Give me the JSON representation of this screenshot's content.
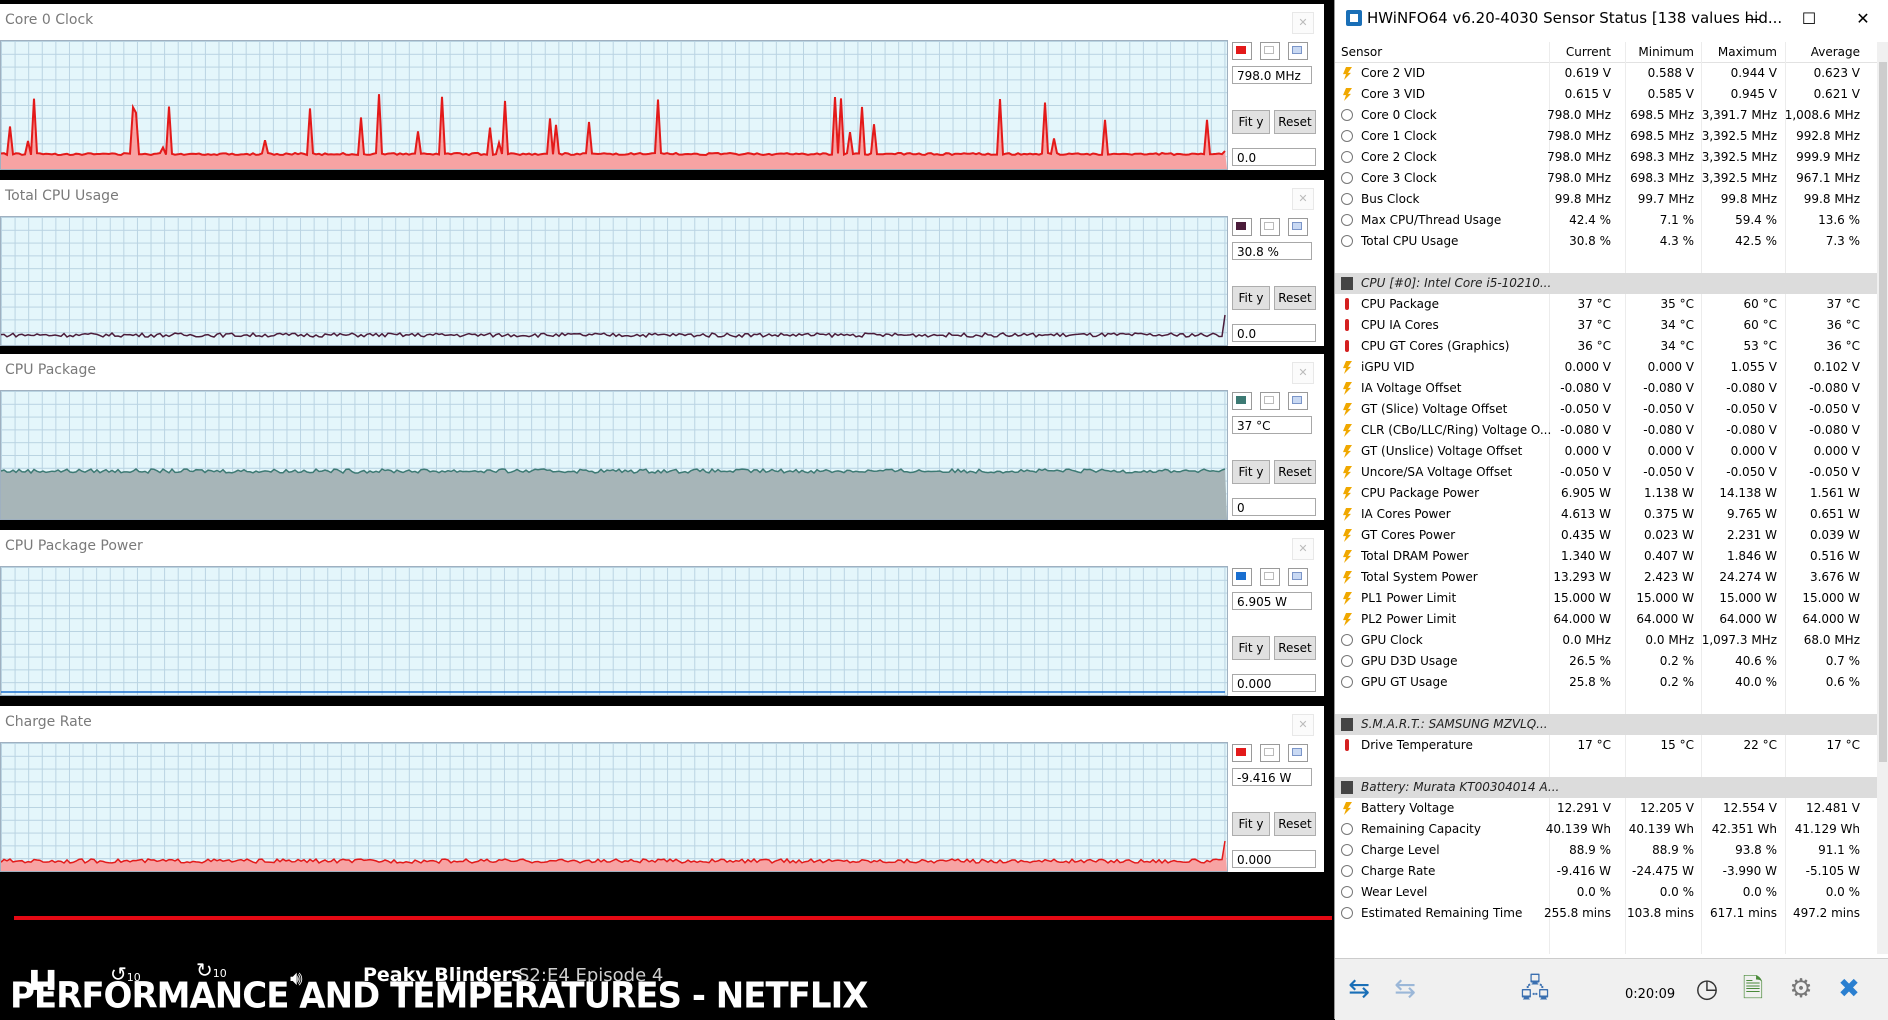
{
  "graphs": [
    {
      "title": "Core 0 Clock",
      "color": "#e31a1a",
      "fill": "#f7a3a3",
      "value": "798.0 MHz",
      "min": "0.0",
      "fit": "Fit y",
      "reset": "Reset",
      "kind": "spikes"
    },
    {
      "title": "Total CPU Usage",
      "color": "#4b1c3a",
      "fill": "",
      "value": "30.8 %",
      "min": "0.0",
      "fit": "Fit y",
      "reset": "Reset",
      "kind": "low"
    },
    {
      "title": "CPU Package",
      "color": "#3d7a74",
      "fill": "#a7b5b8",
      "value": "37 °C",
      "min": "0",
      "fit": "Fit y",
      "reset": "Reset",
      "kind": "mid"
    },
    {
      "title": "CPU Package Power",
      "color": "#1a6fd0",
      "fill": "",
      "value": "6.905 W",
      "min": "0.000",
      "fit": "Fit y",
      "reset": "Reset",
      "kind": "flat"
    },
    {
      "title": "Charge Rate",
      "color": "#e31a1a",
      "fill": "#f7a3a3",
      "value": "-9.416 W",
      "min": "0.000",
      "fit": "Fit y",
      "reset": "Reset",
      "kind": "low"
    }
  ],
  "video": {
    "show_title": "Peaky Blinders",
    "episode": "S2:E4  Episode 4",
    "rewind_label": "10",
    "forward_label": "10",
    "caption": "PERFORMANCE AND TEMPERATURES - NETFLIX"
  },
  "window": {
    "title": "HWiNFO64 v6.20-4030 Sensor Status [138 values hid...",
    "min": "—",
    "max": "☐",
    "close": "✕",
    "headers": [
      "Sensor",
      "Current",
      "Minimum",
      "Maximum",
      "Average"
    ],
    "timer": "0:20:09"
  },
  "rows": [
    {
      "t": "volt",
      "n": "Core 2 VID",
      "c": "0.619 V",
      "mn": "0.588 V",
      "mx": "0.944 V",
      "av": "0.623 V"
    },
    {
      "t": "volt",
      "n": "Core 3 VID",
      "c": "0.615 V",
      "mn": "0.585 V",
      "mx": "0.945 V",
      "av": "0.621 V"
    },
    {
      "t": "clock",
      "n": "Core 0 Clock",
      "c": "798.0 MHz",
      "mn": "698.5 MHz",
      "mx": "3,391.7 MHz",
      "av": "1,008.6 MHz"
    },
    {
      "t": "clock",
      "n": "Core 1 Clock",
      "c": "798.0 MHz",
      "mn": "698.5 MHz",
      "mx": "3,392.5 MHz",
      "av": "992.8 MHz"
    },
    {
      "t": "clock",
      "n": "Core 2 Clock",
      "c": "798.0 MHz",
      "mn": "698.3 MHz",
      "mx": "3,392.5 MHz",
      "av": "999.9 MHz"
    },
    {
      "t": "clock",
      "n": "Core 3 Clock",
      "c": "798.0 MHz",
      "mn": "698.3 MHz",
      "mx": "3,392.5 MHz",
      "av": "967.1 MHz"
    },
    {
      "t": "clock",
      "n": "Bus Clock",
      "c": "99.8 MHz",
      "mn": "99.7 MHz",
      "mx": "99.8 MHz",
      "av": "99.8 MHz"
    },
    {
      "t": "clock",
      "n": "Max CPU/Thread Usage",
      "c": "42.4 %",
      "mn": "7.1 %",
      "mx": "59.4 %",
      "av": "13.6 %"
    },
    {
      "t": "clock",
      "n": "Total CPU Usage",
      "c": "30.8 %",
      "mn": "4.3 %",
      "mx": "42.5 %",
      "av": "7.3 %"
    },
    {
      "t": "blank"
    },
    {
      "t": "group",
      "n": "CPU [#0]: Intel Core i5-10210..."
    },
    {
      "t": "temp",
      "n": "CPU Package",
      "c": "37 °C",
      "mn": "35 °C",
      "mx": "60 °C",
      "av": "37 °C"
    },
    {
      "t": "temp",
      "n": "CPU IA Cores",
      "c": "37 °C",
      "mn": "34 °C",
      "mx": "60 °C",
      "av": "36 °C"
    },
    {
      "t": "temp",
      "n": "CPU GT Cores (Graphics)",
      "c": "36 °C",
      "mn": "34 °C",
      "mx": "53 °C",
      "av": "36 °C"
    },
    {
      "t": "volt",
      "n": "iGPU VID",
      "c": "0.000 V",
      "mn": "0.000 V",
      "mx": "1.055 V",
      "av": "0.102 V"
    },
    {
      "t": "volt",
      "n": "IA Voltage Offset",
      "c": "-0.080 V",
      "mn": "-0.080 V",
      "mx": "-0.080 V",
      "av": "-0.080 V"
    },
    {
      "t": "volt",
      "n": "GT (Slice) Voltage Offset",
      "c": "-0.050 V",
      "mn": "-0.050 V",
      "mx": "-0.050 V",
      "av": "-0.050 V"
    },
    {
      "t": "volt",
      "n": "CLR (CBo/LLC/Ring) Voltage O...",
      "c": "-0.080 V",
      "mn": "-0.080 V",
      "mx": "-0.080 V",
      "av": "-0.080 V"
    },
    {
      "t": "volt",
      "n": "GT (Unslice) Voltage Offset",
      "c": "0.000 V",
      "mn": "0.000 V",
      "mx": "0.000 V",
      "av": "0.000 V"
    },
    {
      "t": "volt",
      "n": "Uncore/SA Voltage Offset",
      "c": "-0.050 V",
      "mn": "-0.050 V",
      "mx": "-0.050 V",
      "av": "-0.050 V"
    },
    {
      "t": "volt",
      "n": "CPU Package Power",
      "c": "6.905 W",
      "mn": "1.138 W",
      "mx": "14.138 W",
      "av": "1.561 W"
    },
    {
      "t": "volt",
      "n": "IA Cores Power",
      "c": "4.613 W",
      "mn": "0.375 W",
      "mx": "9.765 W",
      "av": "0.651 W"
    },
    {
      "t": "volt",
      "n": "GT Cores Power",
      "c": "0.435 W",
      "mn": "0.023 W",
      "mx": "2.231 W",
      "av": "0.039 W"
    },
    {
      "t": "volt",
      "n": "Total DRAM Power",
      "c": "1.340 W",
      "mn": "0.407 W",
      "mx": "1.846 W",
      "av": "0.516 W"
    },
    {
      "t": "volt",
      "n": "Total System Power",
      "c": "13.293 W",
      "mn": "2.423 W",
      "mx": "24.274 W",
      "av": "3.676 W"
    },
    {
      "t": "volt",
      "n": "PL1 Power Limit",
      "c": "15.000 W",
      "mn": "15.000 W",
      "mx": "15.000 W",
      "av": "15.000 W"
    },
    {
      "t": "volt",
      "n": "PL2 Power Limit",
      "c": "64.000 W",
      "mn": "64.000 W",
      "mx": "64.000 W",
      "av": "64.000 W"
    },
    {
      "t": "clock",
      "n": "GPU Clock",
      "c": "0.0 MHz",
      "mn": "0.0 MHz",
      "mx": "1,097.3 MHz",
      "av": "68.0 MHz"
    },
    {
      "t": "clock",
      "n": "GPU D3D Usage",
      "c": "26.5 %",
      "mn": "0.2 %",
      "mx": "40.6 %",
      "av": "0.7 %"
    },
    {
      "t": "clock",
      "n": "GPU GT Usage",
      "c": "25.8 %",
      "mn": "0.2 %",
      "mx": "40.0 %",
      "av": "0.6 %"
    },
    {
      "t": "blank"
    },
    {
      "t": "group",
      "n": "S.M.A.R.T.: SAMSUNG MZVLQ..."
    },
    {
      "t": "temp",
      "n": "Drive Temperature",
      "c": "17 °C",
      "mn": "15 °C",
      "mx": "22 °C",
      "av": "17 °C"
    },
    {
      "t": "blank"
    },
    {
      "t": "group",
      "n": "Battery: Murata KT00304014 A..."
    },
    {
      "t": "volt",
      "n": "Battery Voltage",
      "c": "12.291 V",
      "mn": "12.205 V",
      "mx": "12.554 V",
      "av": "12.481 V"
    },
    {
      "t": "clock",
      "n": "Remaining Capacity",
      "c": "40.139 Wh",
      "mn": "40.139 Wh",
      "mx": "42.351 Wh",
      "av": "41.129 Wh"
    },
    {
      "t": "clock",
      "n": "Charge Level",
      "c": "88.9 %",
      "mn": "88.9 %",
      "mx": "93.8 %",
      "av": "91.1 %"
    },
    {
      "t": "clock",
      "n": "Charge Rate",
      "c": "-9.416 W",
      "mn": "-24.475 W",
      "mx": "-3.990 W",
      "av": "-5.105 W"
    },
    {
      "t": "clock",
      "n": "Wear Level",
      "c": "0.0 %",
      "mn": "0.0 %",
      "mx": "0.0 %",
      "av": "0.0 %"
    },
    {
      "t": "clock",
      "n": "Estimated Remaining Time",
      "c": "255.8 mins",
      "mn": "103.8 mins",
      "mx": "617.1 mins",
      "av": "497.2 mins"
    }
  ]
}
